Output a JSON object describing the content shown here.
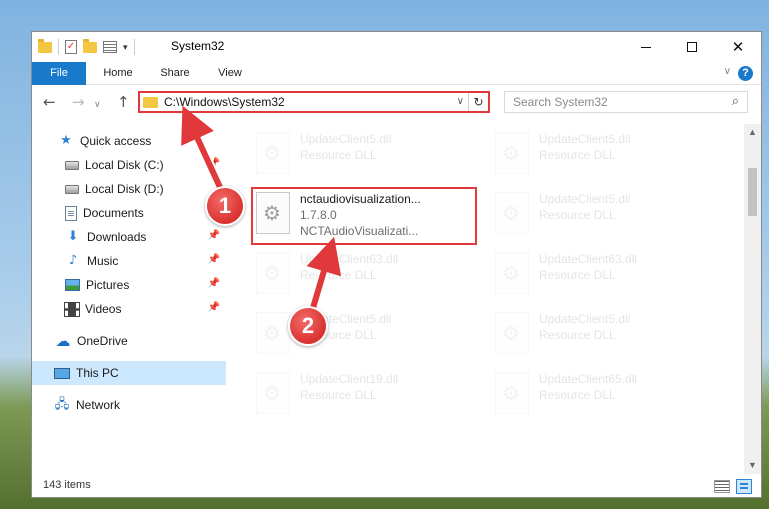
{
  "window": {
    "title": "System32",
    "buttons": {
      "minimize": "minimize",
      "maximize": "maximize",
      "close": "close"
    }
  },
  "ribbon": {
    "tabs": [
      "File",
      "Home",
      "Share",
      "View"
    ],
    "help": "?"
  },
  "navigation": {
    "back": "←",
    "forward": "→",
    "recent": "∨",
    "up": "↑",
    "address": "C:\\Windows\\System32",
    "search_placeholder": "Search System32"
  },
  "sidebar": {
    "items": [
      {
        "label": "Quick access",
        "icon": "star-icon",
        "pinned": false
      },
      {
        "label": "Local Disk (C:)",
        "icon": "drive-icon",
        "pinned": true
      },
      {
        "label": "Local Disk (D:)",
        "icon": "drive-icon",
        "pinned": false
      },
      {
        "label": "Documents",
        "icon": "document-icon",
        "pinned": true
      },
      {
        "label": "Downloads",
        "icon": "download-icon",
        "pinned": true
      },
      {
        "label": "Music",
        "icon": "music-icon",
        "pinned": true
      },
      {
        "label": "Pictures",
        "icon": "picture-icon",
        "pinned": true
      },
      {
        "label": "Videos",
        "icon": "video-icon",
        "pinned": true
      },
      {
        "label": "OneDrive",
        "icon": "cloud-icon",
        "pinned": false
      },
      {
        "label": "This PC",
        "icon": "computer-icon",
        "pinned": false,
        "selected": true
      },
      {
        "label": "Network",
        "icon": "network-icon",
        "pinned": false
      }
    ]
  },
  "files": {
    "highlighted": {
      "name": "nctaudiovisualization...",
      "version": "1.7.8.0",
      "description": "NCTAudioVisualizati..."
    },
    "faded": [
      {
        "name": "UpdateClient5.dll",
        "type": "Resource DLL"
      },
      {
        "name": "UpdateClient5.dll",
        "type": "Resource DLL"
      },
      {
        "name": "UpdateClient5.dll",
        "type": "Resource DLL"
      },
      {
        "name": "UpdateClient63.dll",
        "type": "Resource DLL"
      },
      {
        "name": "UpdateClient63.dll",
        "type": "Resource DLL"
      },
      {
        "name": "UpdateClient5.dll",
        "type": "Resource DLL"
      },
      {
        "name": "UpdateClient5.dll",
        "type": "Resource DLL"
      },
      {
        "name": "UpdateClient19.dll",
        "type": "Resource DLL"
      },
      {
        "name": "UpdateClient65.dll",
        "type": "Resource DLL"
      }
    ]
  },
  "status": {
    "item_count": "143 items"
  },
  "annotations": {
    "step1": "1",
    "step2": "2",
    "color": "#e0383b"
  }
}
